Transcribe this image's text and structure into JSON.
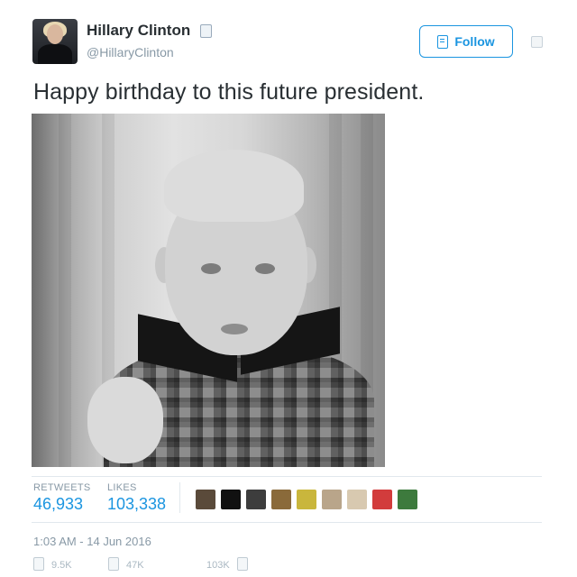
{
  "profile": {
    "name": "Hillary Clinton",
    "handle": "@HillaryClinton"
  },
  "header": {
    "follow_label": "Follow"
  },
  "tweet": {
    "text": "Happy birthday to this future president.",
    "timestamp": "1:03 AM - 14 Jun 2016"
  },
  "stats": {
    "retweets_label": "RETWEETS",
    "retweets_value": "46,933",
    "likes_label": "LIKES",
    "likes_value": "103,338"
  },
  "likers": [
    {
      "color": "#5a4a3a"
    },
    {
      "color": "#111111"
    },
    {
      "color": "#3d3d3d"
    },
    {
      "color": "#8a6a3a"
    },
    {
      "color": "#c9b63c"
    },
    {
      "color": "#b9a58a"
    },
    {
      "color": "#d8c9b0"
    },
    {
      "color": "#d23c3c"
    },
    {
      "color": "#3d7a3d"
    }
  ],
  "actions": {
    "replies": "9.5K",
    "retweets": "47K",
    "likes": "103K"
  },
  "colors": {
    "accent": "#1b95e0",
    "muted": "#8899a6"
  }
}
